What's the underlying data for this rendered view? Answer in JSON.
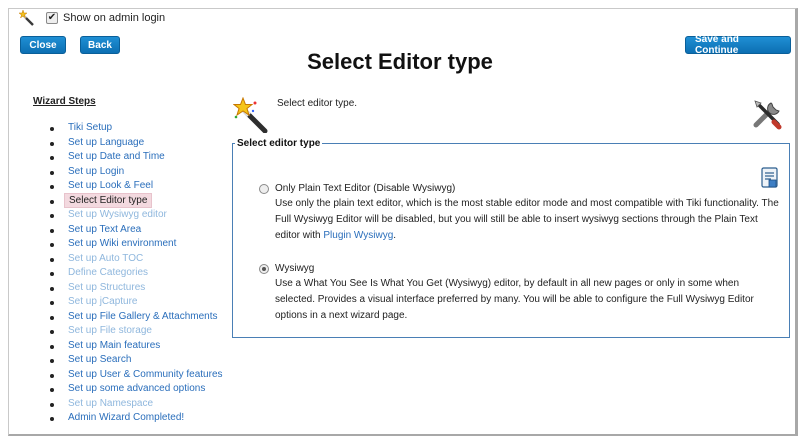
{
  "topbar": {
    "show_on_login_label": "Show on admin login",
    "show_on_login_checked": true
  },
  "buttons": {
    "close": "Close",
    "back": "Back",
    "save_continue": "Save and Continue"
  },
  "page_title": "Select Editor type",
  "wizard": {
    "heading": "Wizard Steps",
    "steps": [
      {
        "label": "Tiki Setup",
        "state": "link"
      },
      {
        "label": "Set up Language",
        "state": "link"
      },
      {
        "label": "Set up Date and Time",
        "state": "link"
      },
      {
        "label": "Set up Login",
        "state": "link"
      },
      {
        "label": "Set up Look & Feel",
        "state": "link"
      },
      {
        "label": "Select Editor type",
        "state": "current"
      },
      {
        "label": "Set up Wysiwyg editor",
        "state": "disabled"
      },
      {
        "label": "Set up Text Area",
        "state": "link"
      },
      {
        "label": "Set up Wiki environment",
        "state": "link"
      },
      {
        "label": "Set up Auto TOC",
        "state": "disabled"
      },
      {
        "label": "Define Categories",
        "state": "disabled"
      },
      {
        "label": "Set up Structures",
        "state": "disabled"
      },
      {
        "label": "Set up jCapture",
        "state": "disabled"
      },
      {
        "label": "Set up File Gallery & Attachments",
        "state": "link"
      },
      {
        "label": "Set up File storage",
        "state": "disabled"
      },
      {
        "label": "Set up Main features",
        "state": "link"
      },
      {
        "label": "Set up Search",
        "state": "link"
      },
      {
        "label": "Set up User & Community features",
        "state": "link"
      },
      {
        "label": "Set up some advanced options",
        "state": "link"
      },
      {
        "label": "Set up Namespace",
        "state": "disabled"
      },
      {
        "label": "Admin Wizard Completed!",
        "state": "link"
      }
    ]
  },
  "intro_text": "Select editor type.",
  "editor_section": {
    "legend": "Select editor type",
    "options": [
      {
        "label": "Only Plain Text Editor (Disable Wysiwyg)",
        "selected": false,
        "desc_before": "Use only the plain text editor, which is the most stable editor mode and most compatible with Tiki functionality. The Full Wysiwyg Editor will be disabled, but you will still be able to insert wysiwyg sections through the Plain Text editor with ",
        "link": "Plugin Wysiwyg",
        "desc_after": "."
      },
      {
        "label": "Wysiwyg",
        "selected": true,
        "desc": "Use a What You See Is What You Get (Wysiwyg) editor, by default in all new pages or only in some when selected. Provides a visual interface preferred by many. You will be able to configure the Full Wysiwyg Editor options in a next wizard page."
      }
    ]
  },
  "icons": {
    "wand": "magic-wand-icon",
    "tools": "tools-icon",
    "document": "document-icon"
  },
  "colors": {
    "button": "#1479c1",
    "link": "#2a6ebb",
    "link_disabled": "#8fb7dd",
    "current_step_bg": "#f3d9df",
    "fieldset_border": "#4a7fb5"
  }
}
